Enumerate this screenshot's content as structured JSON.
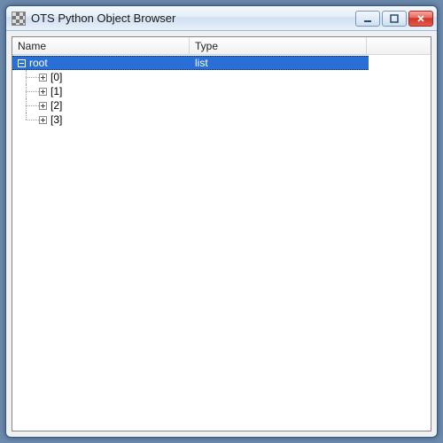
{
  "window": {
    "title": "OTS Python Object Browser"
  },
  "columns": {
    "name": "Name",
    "type": "Type"
  },
  "tree": {
    "root": {
      "label": "root",
      "type": "list",
      "expanded": true,
      "selected": true,
      "children": [
        {
          "label": "[0]",
          "type": "",
          "expandable": true
        },
        {
          "label": "[1]",
          "type": "",
          "expandable": true
        },
        {
          "label": "[2]",
          "type": "",
          "expandable": true
        },
        {
          "label": "[3]",
          "type": "",
          "expandable": true
        }
      ]
    }
  }
}
